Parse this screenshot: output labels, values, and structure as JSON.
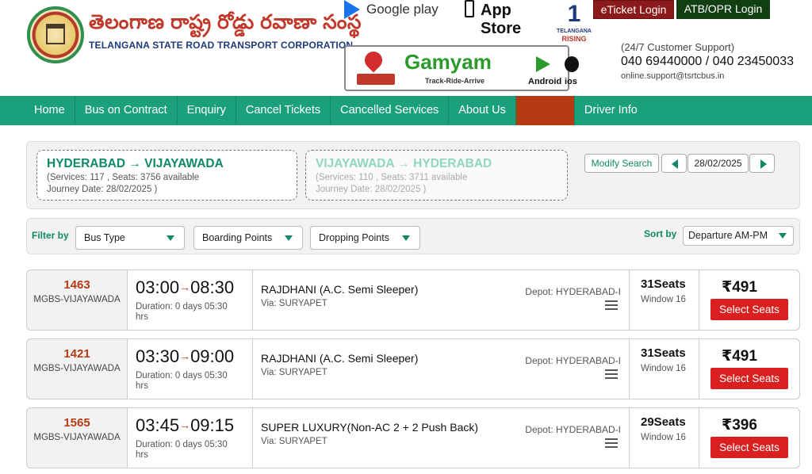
{
  "header": {
    "brand_telugu": "తెలంగాణ రాష్ట్ర రోడ్డు రవాణా సంస్థ",
    "brand_english": "TELANGANA STATE ROAD TRANSPORT CORPORATION",
    "google_play": "Google play",
    "app_store": "App Store",
    "ts_rising_num": "1",
    "ts_rising_1": "TELANGANA",
    "ts_rising_2": "RISING",
    "eticket_login": "eTicket Login",
    "atb_login": "ATB/OPR Login",
    "gamyam": {
      "title": "Gamyam",
      "tagline": "Track-Ride-Arrive",
      "android": "Android",
      "ios": "ios"
    },
    "support": {
      "label": "(24/7 Customer Support)",
      "phones": "040 69440000 / 040 23450033",
      "email": "online.support@tsrtcbus.in"
    }
  },
  "nav": {
    "items": [
      "Home",
      "Bus on Contract",
      "Enquiry",
      "Cancel Tickets",
      "Cancelled Services",
      "About Us",
      "",
      "Driver Info"
    ]
  },
  "journey": {
    "onward": {
      "title": "HYDERABAD → VIJAYAWADA",
      "services": "(Services: 117 , Seats: 3756 available",
      "date": "Journey Date: 28/02/2025 )"
    },
    "return": {
      "title": "VIJAYAWADA → HYDERABAD",
      "services": "(Services: 110 , Seats: 3711 available",
      "date": "Journey Date: 28/02/2025 )"
    },
    "modify_search": "Modify Search",
    "selected_date": "28/02/2025"
  },
  "filters": {
    "label": "Filter by",
    "bus_type": "Bus Type",
    "boarding": "Boarding Points",
    "dropping": "Dropping Points",
    "sort_label": "Sort by",
    "sort_value": "Departure AM-PM"
  },
  "buses": [
    {
      "service_no": "1463",
      "route": "MGBS-VIJAYAWADA",
      "dep": "03:00",
      "arr": "08:30",
      "duration": "Duration: 0 days 05:30 hrs",
      "name": "RAJDHANI (A.C. Semi Sleeper)",
      "via": "Via: SURYAPET",
      "depot": "Depot: HYDERABAD-I",
      "seats": "31Seats",
      "window": "Window 16",
      "fare": "₹491",
      "button": "Select Seats"
    },
    {
      "service_no": "1421",
      "route": "MGBS-VIJAYAWADA",
      "dep": "03:30",
      "arr": "09:00",
      "duration": "Duration: 0 days 05:30 hrs",
      "name": "RAJDHANI (A.C. Semi Sleeper)",
      "via": "Via: SURYAPET",
      "depot": "Depot: HYDERABAD-I",
      "seats": "31Seats",
      "window": "Window 16",
      "fare": "₹491",
      "button": "Select Seats"
    },
    {
      "service_no": "1565",
      "route": "MGBS-VIJAYAWADA",
      "dep": "03:45",
      "arr": "09:15",
      "duration": "Duration: 0 days 05:30 hrs",
      "name": "SUPER LUXURY(Non-AC 2 + 2 Push Back)",
      "via": "Via: SURYAPET",
      "depot": "Depot: HYDERABAD-I",
      "seats": "29Seats",
      "window": "Window 16",
      "fare": "₹396",
      "button": "Select Seats"
    }
  ],
  "colors": {
    "nav_green": "#1aa07a",
    "accent_green": "#0e8a66",
    "select_red": "#d91f1f",
    "service_red": "#b53a12"
  }
}
